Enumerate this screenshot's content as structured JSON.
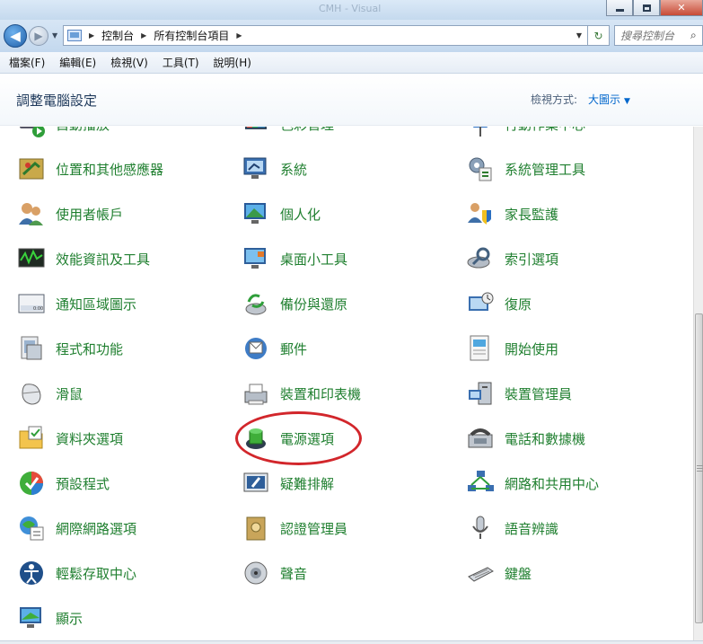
{
  "window": {
    "title": "CMH - Visual",
    "min_glyph": "",
    "max_glyph": "",
    "close_glyph": "✕"
  },
  "address_bar": {
    "back_glyph": "◀",
    "forward_glyph": "▶",
    "breadcrumbs": [
      "控制台",
      "所有控制台項目"
    ],
    "search_placeholder": "搜尋控制台",
    "refresh_glyph": "↻",
    "search_glyph": "⌕"
  },
  "menu": {
    "items": [
      "檔案(F)",
      "編輯(E)",
      "檢視(V)",
      "工具(T)",
      "說明(H)"
    ]
  },
  "header": {
    "title": "調整電腦設定",
    "view_label": "檢視方式:",
    "view_value": "大圖示"
  },
  "items": [
    {
      "label": "自動播放",
      "icon": "autoplay-icon"
    },
    {
      "label": "色彩管理",
      "icon": "color-management-icon"
    },
    {
      "label": "行動作業中心",
      "icon": "action-center-icon"
    },
    {
      "label": "位置和其他感應器",
      "icon": "location-sensors-icon"
    },
    {
      "label": "系統",
      "icon": "system-icon"
    },
    {
      "label": "系統管理工具",
      "icon": "admin-tools-icon"
    },
    {
      "label": "使用者帳戶",
      "icon": "user-accounts-icon"
    },
    {
      "label": "個人化",
      "icon": "personalization-icon"
    },
    {
      "label": "家長監護",
      "icon": "parental-controls-icon"
    },
    {
      "label": "效能資訊及工具",
      "icon": "performance-icon"
    },
    {
      "label": "桌面小工具",
      "icon": "desktop-gadgets-icon"
    },
    {
      "label": "索引選項",
      "icon": "indexing-options-icon"
    },
    {
      "label": "通知區域圖示",
      "icon": "notification-icons-icon"
    },
    {
      "label": "備份與還原",
      "icon": "backup-restore-icon"
    },
    {
      "label": "復原",
      "icon": "recovery-icon"
    },
    {
      "label": "程式和功能",
      "icon": "programs-features-icon"
    },
    {
      "label": "郵件",
      "icon": "mail-icon"
    },
    {
      "label": "開始使用",
      "icon": "getting-started-icon"
    },
    {
      "label": "滑鼠",
      "icon": "mouse-icon"
    },
    {
      "label": "裝置和印表機",
      "icon": "devices-printers-icon"
    },
    {
      "label": "裝置管理員",
      "icon": "device-manager-icon"
    },
    {
      "label": "資料夾選項",
      "icon": "folder-options-icon"
    },
    {
      "label": "電源選項",
      "icon": "power-options-icon"
    },
    {
      "label": "電話和數據機",
      "icon": "phone-modem-icon"
    },
    {
      "label": "預設程式",
      "icon": "default-programs-icon"
    },
    {
      "label": "疑難排解",
      "icon": "troubleshooting-icon"
    },
    {
      "label": "網路和共用中心",
      "icon": "network-sharing-icon"
    },
    {
      "label": "網際網路選項",
      "icon": "internet-options-icon"
    },
    {
      "label": "認證管理員",
      "icon": "credential-manager-icon"
    },
    {
      "label": "語音辨識",
      "icon": "speech-recognition-icon"
    },
    {
      "label": "輕鬆存取中心",
      "icon": "ease-of-access-icon"
    },
    {
      "label": "聲音",
      "icon": "sound-icon"
    },
    {
      "label": "鍵盤",
      "icon": "keyboard-icon"
    },
    {
      "label": "顯示",
      "icon": "display-icon"
    }
  ],
  "colors": {
    "link_green": "#1f7f2f",
    "link_blue": "#0066cc",
    "highlight_red": "#d2262b"
  }
}
